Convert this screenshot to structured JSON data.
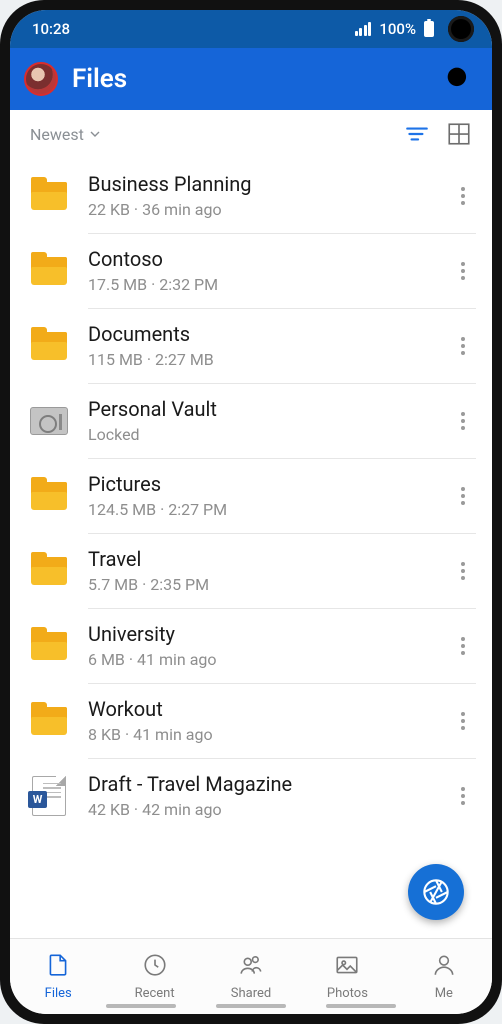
{
  "status": {
    "time": "10:28",
    "battery": "100%"
  },
  "header": {
    "title": "Files"
  },
  "toolbar": {
    "sort_label": "Newest"
  },
  "files": [
    {
      "name": "Business Planning",
      "meta": "22 KB · 36 min ago",
      "icon": "folder"
    },
    {
      "name": "Contoso",
      "meta": "17.5 MB · 2:32 PM",
      "icon": "folder"
    },
    {
      "name": "Documents",
      "meta": "115 MB · 2:27 MB",
      "icon": "folder"
    },
    {
      "name": "Personal Vault",
      "meta": "Locked",
      "icon": "vault"
    },
    {
      "name": "Pictures",
      "meta": "124.5 MB · 2:27 PM",
      "icon": "folder"
    },
    {
      "name": "Travel",
      "meta": "5.7 MB · 2:35 PM",
      "icon": "folder"
    },
    {
      "name": "University",
      "meta": "6 MB · 41 min ago",
      "icon": "folder"
    },
    {
      "name": "Workout",
      "meta": "8 KB · 41 min ago",
      "icon": "folder"
    },
    {
      "name": "Draft - Travel Magazine",
      "meta": "42 KB · 42 min ago",
      "icon": "word"
    }
  ],
  "nav": [
    {
      "label": "Files",
      "active": true
    },
    {
      "label": "Recent",
      "active": false
    },
    {
      "label": "Shared",
      "active": false
    },
    {
      "label": "Photos",
      "active": false
    },
    {
      "label": "Me",
      "active": false
    }
  ]
}
